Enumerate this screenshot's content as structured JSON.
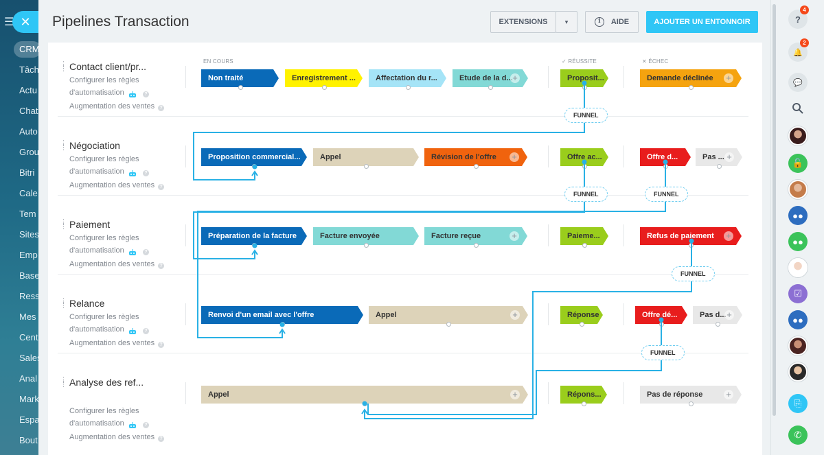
{
  "left_sidebar": {
    "crm": "CRM",
    "items": [
      "Tâch",
      "Actu",
      "Chat",
      "Auto",
      "Grou",
      "Bitri",
      "Cale",
      "Tem",
      "Sites",
      "Emp",
      "Base",
      "Ress",
      "Mes",
      "Cent",
      "Sales",
      "Anal",
      "Mark",
      "Espa",
      "Bout"
    ]
  },
  "header": {
    "title": "Pipelines Transaction",
    "extensions": "EXTENSIONS",
    "extensions_arrow": "▾",
    "aide": "AIDE",
    "add_funnel": "AJOUTER UN ENTONNOIR"
  },
  "columns": {
    "in_progress": "EN COURS",
    "success": "RÉUSSITE",
    "failure": "ÉCHEC"
  },
  "common": {
    "automation_line1": "Configurer les règles",
    "automation_line2": "d'automatisation",
    "sales_boost": "Augmentation des ventes",
    "funnel": "FUNNEL"
  },
  "pipelines": [
    {
      "title": "Contact client/pr...",
      "stages": [
        "Non traité",
        "Enregistrement ...",
        "Affectation du r...",
        "Etude de la d..."
      ],
      "success": "Proposit...",
      "failure": [
        "Demande déclinée"
      ]
    },
    {
      "title": "Négociation",
      "stages": [
        "Proposition commercial...",
        "Appel",
        "Révision de l'offre"
      ],
      "success": "Offre ac...",
      "failure": [
        "Offre d...",
        "Pas ..."
      ]
    },
    {
      "title": "Paiement",
      "stages": [
        "Préparation de la facture",
        "Facture envoyée",
        "Facture reçue"
      ],
      "success": "Paieme...",
      "failure": [
        "Refus de paiement"
      ]
    },
    {
      "title": "Relance",
      "stages": [
        "Renvoi d'un email avec l'offre",
        "Appel"
      ],
      "success": "Réponse",
      "failure": [
        "Offre dé...",
        "Pas d..."
      ]
    },
    {
      "title": "Analyse des ref...",
      "stages": [
        "Appel"
      ],
      "success": "Répons...",
      "failure": [
        "Pas de réponse"
      ]
    }
  ],
  "colors": {
    "accent": "#2fc6f6",
    "blue": "#0a6ab8",
    "yellow": "#fff200",
    "light_blue": "#a5e4f7",
    "teal": "#82d9d6",
    "success_green": "#9acd1c",
    "orange": "#f5a30f",
    "red": "#e81d1d",
    "red_orange": "#f0630e",
    "beige": "#ddd3b9",
    "gray": "#e8e8e8",
    "connector": "#29b1e5"
  },
  "right_sidebar": {
    "help_badge": "4",
    "notifications_badge": "2",
    "icons": [
      "help-icon",
      "bell-icon",
      "chat-icon",
      "search-icon",
      "avatar",
      "lock-icon",
      "avatar",
      "group-icon",
      "group-icon",
      "avatar",
      "task-icon",
      "group-icon",
      "avatar",
      "avatar",
      "open-lines-icon",
      "phone-icon"
    ]
  }
}
